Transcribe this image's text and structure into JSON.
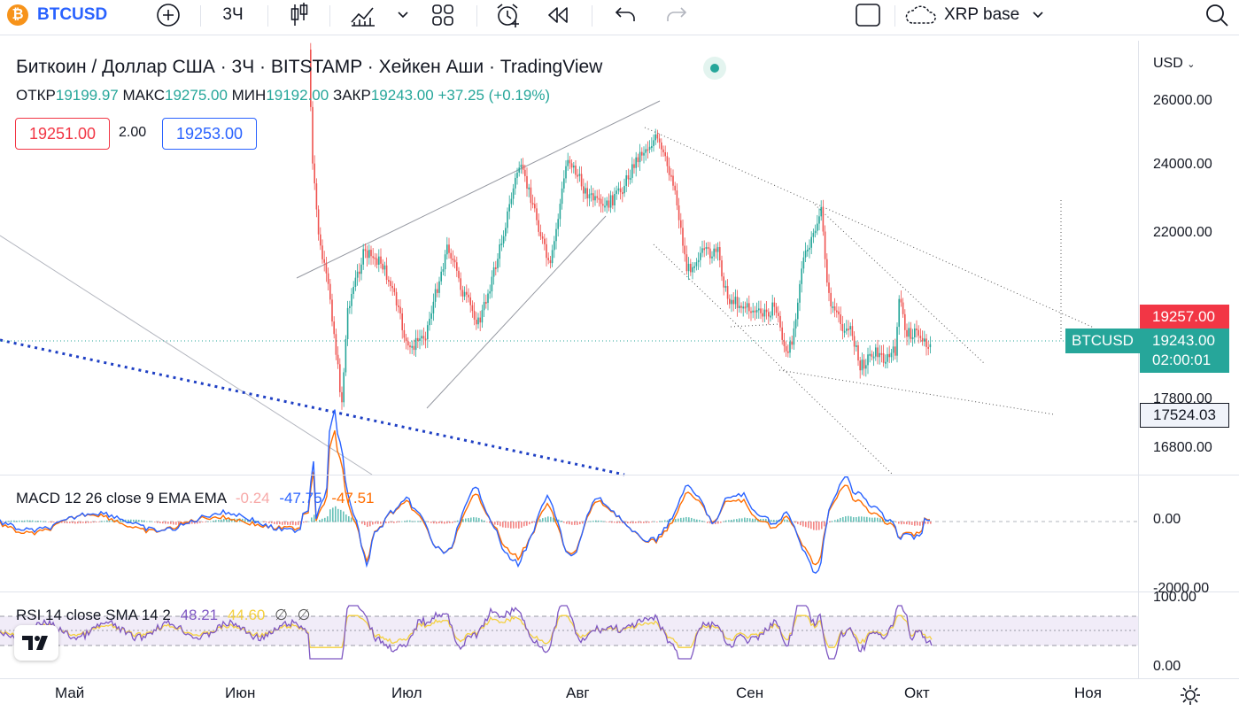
{
  "toolbar": {
    "symbol": "BTCUSD",
    "interval": "3Ч",
    "layout_name": "XRP base"
  },
  "legend": {
    "title": "Биткоин / Доллар США · 3Ч · BITSTAMP · Хейкен Аши · TradingView",
    "open_label": "ОТКР",
    "open": "19199.97",
    "high_label": "МАКС",
    "high": "19275.00",
    "low_label": "МИН",
    "low": "19192.00",
    "close_label": "ЗАКР",
    "close": "19243.00",
    "change": "+37.25 (+0.19%)"
  },
  "trade": {
    "sell": "19251.00",
    "spread": "2.00",
    "buy": "19253.00"
  },
  "price_axis": {
    "currency": "USD",
    "ticks": [
      "26000.00",
      "24000.00",
      "22000.00",
      "17800.00",
      "16800.00"
    ],
    "tag_red": "19257.00",
    "tag_last": "19243.00",
    "tag_timer": "02:00:01",
    "tag_low": "17524.03",
    "symbol_tag": "BTCUSD"
  },
  "macd": {
    "legend": "MACD 12 26 close 9 EMA EMA",
    "hist": "-0.24",
    "macd": "-47.75",
    "signal": "-47.51",
    "ticks": [
      "0.00",
      "-2000.00"
    ]
  },
  "rsi": {
    "legend": "RSI 14 close SMA 14 2",
    "rsi": "48.21",
    "sma": "44.60",
    "extra1": "∅",
    "extra2": "∅",
    "ticks": [
      "100.00",
      "0.00"
    ]
  },
  "time_axis": {
    "labels": [
      "Май",
      "Июн",
      "Июл",
      "Авг",
      "Сен",
      "Окт",
      "Ноя"
    ]
  },
  "colors": {
    "up": "#26a69a",
    "down": "#ef5350",
    "accent": "#2962ff",
    "macd_line": "#2962ff",
    "signal_line": "#ff6d00",
    "rsi_line": "#7e57c2",
    "rsi_sma": "#f4d03f"
  }
}
